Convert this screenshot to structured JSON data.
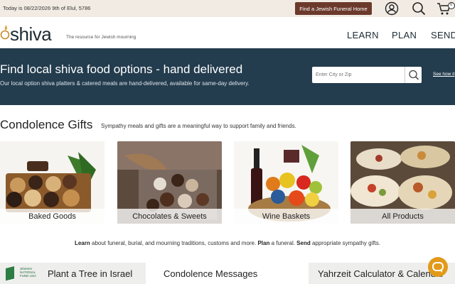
{
  "topbar": {
    "date_text": "Today is 08/22/2026 9th of Elul, 5786",
    "funeral_button": "Find a Jewish Funeral Home",
    "cart_count": "0",
    "icons": [
      "user-icon",
      "search-icon",
      "cart-icon"
    ]
  },
  "header": {
    "logo_text": "shiva",
    "tagline": "The resource for Jewish mourning",
    "nav": [
      "LEARN",
      "PLAN",
      "SEND"
    ]
  },
  "hero": {
    "title": "Find local shiva food options - hand delivered",
    "subtitle": "Our local option shiva platters & catered meals are hand-delivered, available for same-day delivery.",
    "search_placeholder": "Enter City or Zip",
    "how_it_works": "See how it"
  },
  "condolence": {
    "title": "Condolence Gifts",
    "subtitle": "Sympathy meals and gifts are a meaningful way to support family and friends.",
    "cards": [
      {
        "label": "Baked Goods"
      },
      {
        "label": "Chocolates & Sweets"
      },
      {
        "label": "Wine Baskets"
      },
      {
        "label": "All Products"
      }
    ]
  },
  "info": {
    "learn": "Learn",
    "text1": " about funeral, burial, and mourning traditions, customs and more. ",
    "plan": "Plan",
    "text2": " a funeral. ",
    "send": "Send",
    "text3": " appropriate sympathy gifts."
  },
  "bottom": {
    "jnf_text": "JEWISH NATIONAL FUND USA",
    "tree": "Plant a Tree in Israel",
    "messages": "Condolence Messages",
    "yahrzeit": "Yahrzeit Calculator & Calendar"
  },
  "colors": {
    "topbar_bg": "#f1ebe3",
    "funeral_button_bg": "#6b3a2c",
    "hero_bg": "#233c4e",
    "chat_bg": "#e29a1a"
  }
}
